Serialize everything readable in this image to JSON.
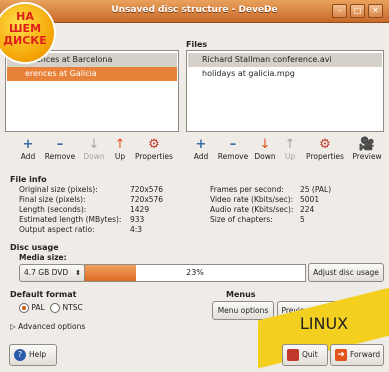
{
  "window": {
    "title": "Unsaved disc structure - DeveDe",
    "min_label": "–",
    "max_label": "□",
    "close_label": "✕"
  },
  "badge": {
    "line1": "НА",
    "line2": "ДИСКЕ",
    "line3": "ШЕМ"
  },
  "titles": {
    "title_label": "",
    "files_label": "Files"
  },
  "titles_list": [
    "ferences at Barcelona",
    "erences at Galicia"
  ],
  "files_list": [
    "Richard Stallman conference.avi",
    "holidays at galicia.mpg"
  ],
  "left_toolbar": [
    {
      "label": "Add",
      "icon": "add-icon"
    },
    {
      "label": "Remove",
      "icon": "remove-icon"
    },
    {
      "label": "Down",
      "icon": "down-icon"
    },
    {
      "label": "Up",
      "icon": "up-icon"
    },
    {
      "label": "Properties",
      "icon": "properties-icon"
    }
  ],
  "right_toolbar": [
    {
      "label": "Add",
      "icon": "add-icon"
    },
    {
      "label": "Remove",
      "icon": "remove-icon"
    },
    {
      "label": "Down",
      "icon": "down-icon"
    },
    {
      "label": "Up",
      "icon": "up-icon"
    },
    {
      "label": "Properties",
      "icon": "properties-icon"
    },
    {
      "label": "Preview",
      "icon": "preview-icon"
    }
  ],
  "file_info": {
    "heading": "File info",
    "left": [
      {
        "label": "Original size (pixels):",
        "value": "720x576"
      },
      {
        "label": "Final size (pixels):",
        "value": "720x576"
      },
      {
        "label": "Length (seconds):",
        "value": "1429"
      },
      {
        "label": "Estimated length (MBytes):",
        "value": "933"
      },
      {
        "label": "Output aspect ratio:",
        "value": "4:3"
      }
    ],
    "right": [
      {
        "label": "Frames per second:",
        "value": "25 (PAL)"
      },
      {
        "label": "Video rate (Kbits/sec):",
        "value": "5001"
      },
      {
        "label": "Audio rate (Kbits/sec):",
        "value": "224"
      },
      {
        "label": "Size of chapters:",
        "value": "5"
      }
    ]
  },
  "disc_usage": {
    "heading": "Disc usage",
    "media_label": "Media size:",
    "media_value": "4.7 GB DVD",
    "percent": 23,
    "percent_label": "23%",
    "adjust_button": "Adjust disc usage"
  },
  "default_format": {
    "heading": "Default format",
    "pal": "PAL",
    "ntsc": "NTSC",
    "selected": "PAL"
  },
  "menus": {
    "heading": "Menus",
    "menu_options": "Menu options",
    "preview_menu": "Preview menu"
  },
  "advanced": {
    "label": "Advanced options"
  },
  "bottom": {
    "help": "Help",
    "quit": "Quit",
    "forward": "Forward"
  },
  "overlay": {
    "linux": "LINUX"
  },
  "colors": {
    "accent": "#dc6a22",
    "titlebar": "#c8692a"
  }
}
